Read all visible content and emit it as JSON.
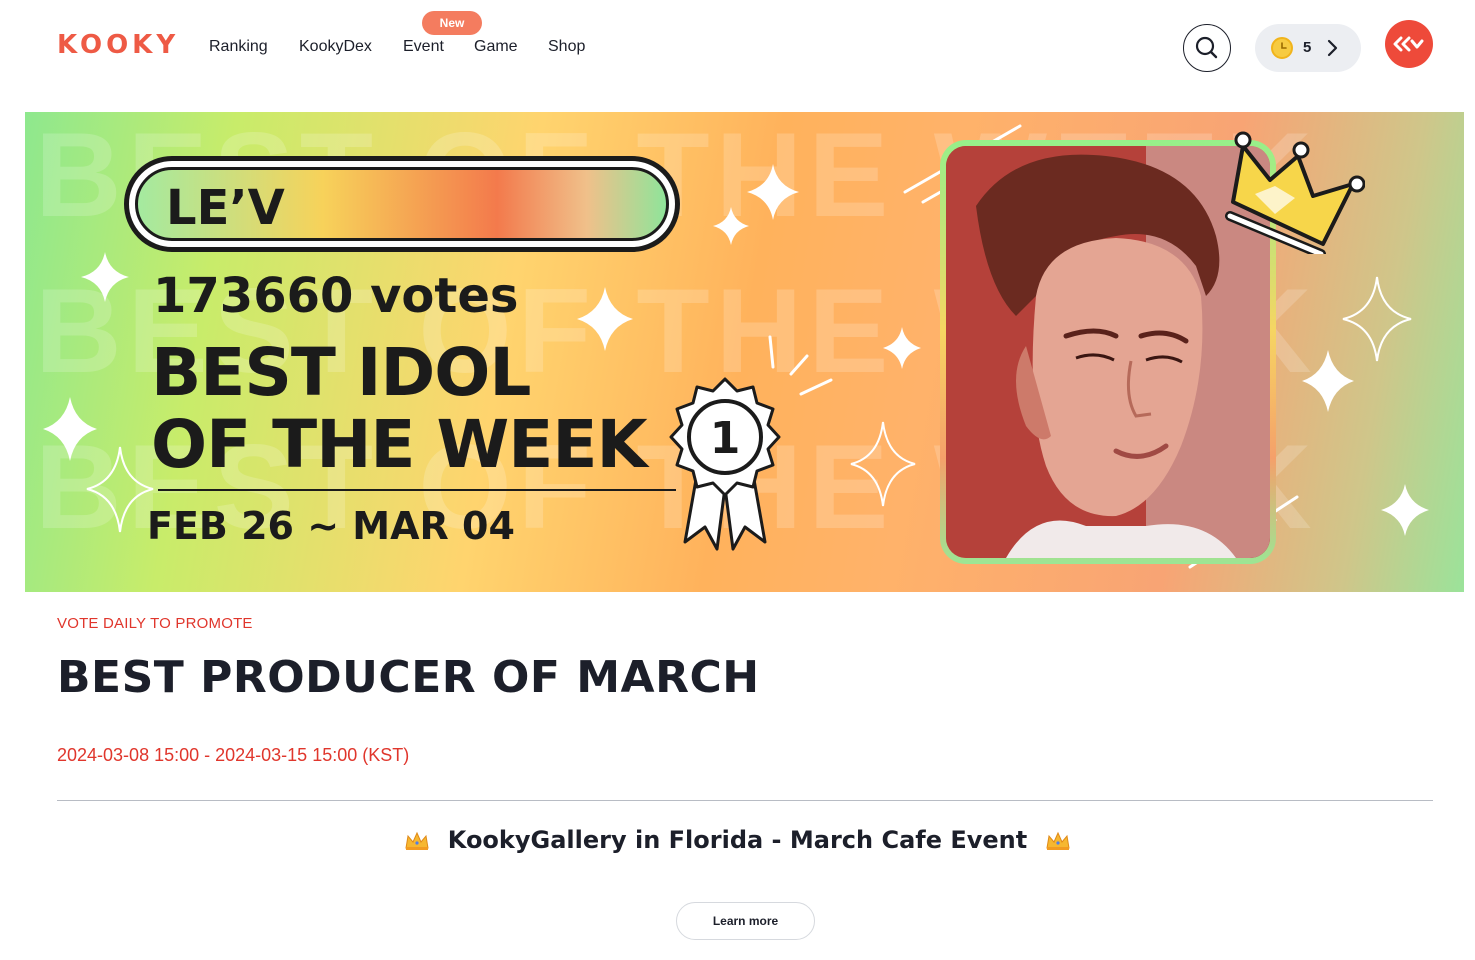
{
  "header": {
    "logo": "KOOKY",
    "nav": [
      "Ranking",
      "KookyDex",
      "Event",
      "Game",
      "Shop"
    ],
    "event_badge": "New",
    "coin_count": "5"
  },
  "banner": {
    "idol_name": "LE’V",
    "votes": "173660 votes",
    "headline_line1": "BEST IDOL",
    "headline_line2": "OF THE WEEK",
    "date_range": "FEB 26 ~ MAR 04",
    "rank_badge": "1",
    "watermark": "BEST OF THE WEEK"
  },
  "content": {
    "kicker": "VOTE DAILY TO PROMOTE",
    "title": "BEST PRODUCER OF MARCH",
    "period": "2024-03-08 15:00 - 2024-03-15 15:00 (KST)",
    "event_title": "KookyGallery in Florida - March Cafe Event",
    "learn_more": "Learn more"
  },
  "colors": {
    "brand": "#ee5a45",
    "accent_red": "#e0362c",
    "badge": "#f47c5f",
    "text": "#1c1f2a"
  },
  "icons": [
    "search-icon",
    "coin-icon",
    "chevron-right-icon",
    "avatar-logo-icon",
    "crown-icon",
    "rank-ribbon-icon",
    "sparkle-icon"
  ]
}
